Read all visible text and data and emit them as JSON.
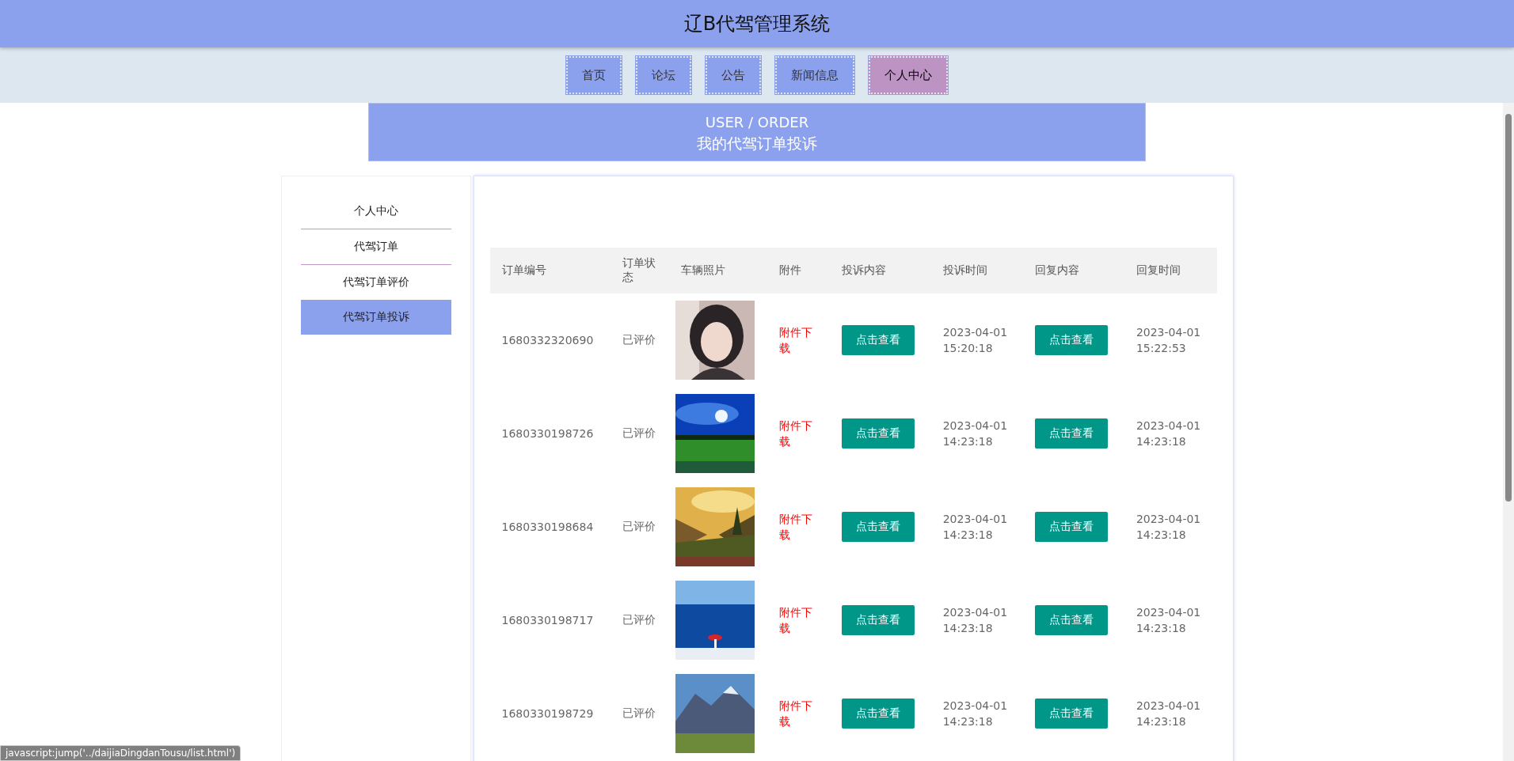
{
  "header": {
    "title": "辽B代驾管理系统"
  },
  "nav": [
    {
      "label": "首页",
      "selected": false
    },
    {
      "label": "论坛",
      "selected": false
    },
    {
      "label": "公告",
      "selected": false
    },
    {
      "label": "新闻信息",
      "selected": false
    },
    {
      "label": "个人中心",
      "selected": true
    }
  ],
  "banner": {
    "subtitle": "USER / ORDER",
    "title": "我的代驾订单投诉"
  },
  "sidebar": {
    "items": [
      {
        "label": "个人中心",
        "selected": false
      },
      {
        "label": "代驾订单",
        "selected": false
      },
      {
        "label": "代驾订单评价",
        "selected": false
      },
      {
        "label": "代驾订单投诉",
        "selected": true
      }
    ]
  },
  "table": {
    "columns": [
      "订单编号",
      "订单状态",
      "车辆照片",
      "附件",
      "投诉内容",
      "投诉时间",
      "回复内容",
      "回复时间"
    ],
    "rows": [
      {
        "order_no": "1680332320690",
        "status": "已评价",
        "attachment": "附件下载",
        "complaint": "点击查看",
        "complaint_time": "2023-04-01 15:20:18",
        "reply": "点击查看",
        "reply_time": "2023-04-01 15:22:53"
      },
      {
        "order_no": "1680330198726",
        "status": "已评价",
        "attachment": "附件下载",
        "complaint": "点击查看",
        "complaint_time": "2023-04-01 14:23:18",
        "reply": "点击查看",
        "reply_time": "2023-04-01 14:23:18"
      },
      {
        "order_no": "1680330198684",
        "status": "已评价",
        "attachment": "附件下载",
        "complaint": "点击查看",
        "complaint_time": "2023-04-01 14:23:18",
        "reply": "点击查看",
        "reply_time": "2023-04-01 14:23:18"
      },
      {
        "order_no": "1680330198717",
        "status": "已评价",
        "attachment": "附件下载",
        "complaint": "点击查看",
        "complaint_time": "2023-04-01 14:23:18",
        "reply": "点击查看",
        "reply_time": "2023-04-01 14:23:18"
      },
      {
        "order_no": "1680330198729",
        "status": "已评价",
        "attachment": "附件下载",
        "complaint": "点击查看",
        "complaint_time": "2023-04-01 14:23:18",
        "reply": "点击查看",
        "reply_time": "2023-04-01 14:23:18"
      }
    ]
  },
  "status_bar": {
    "text": "javascript:jump('../daijiaDingdanTousu/list.html')"
  }
}
